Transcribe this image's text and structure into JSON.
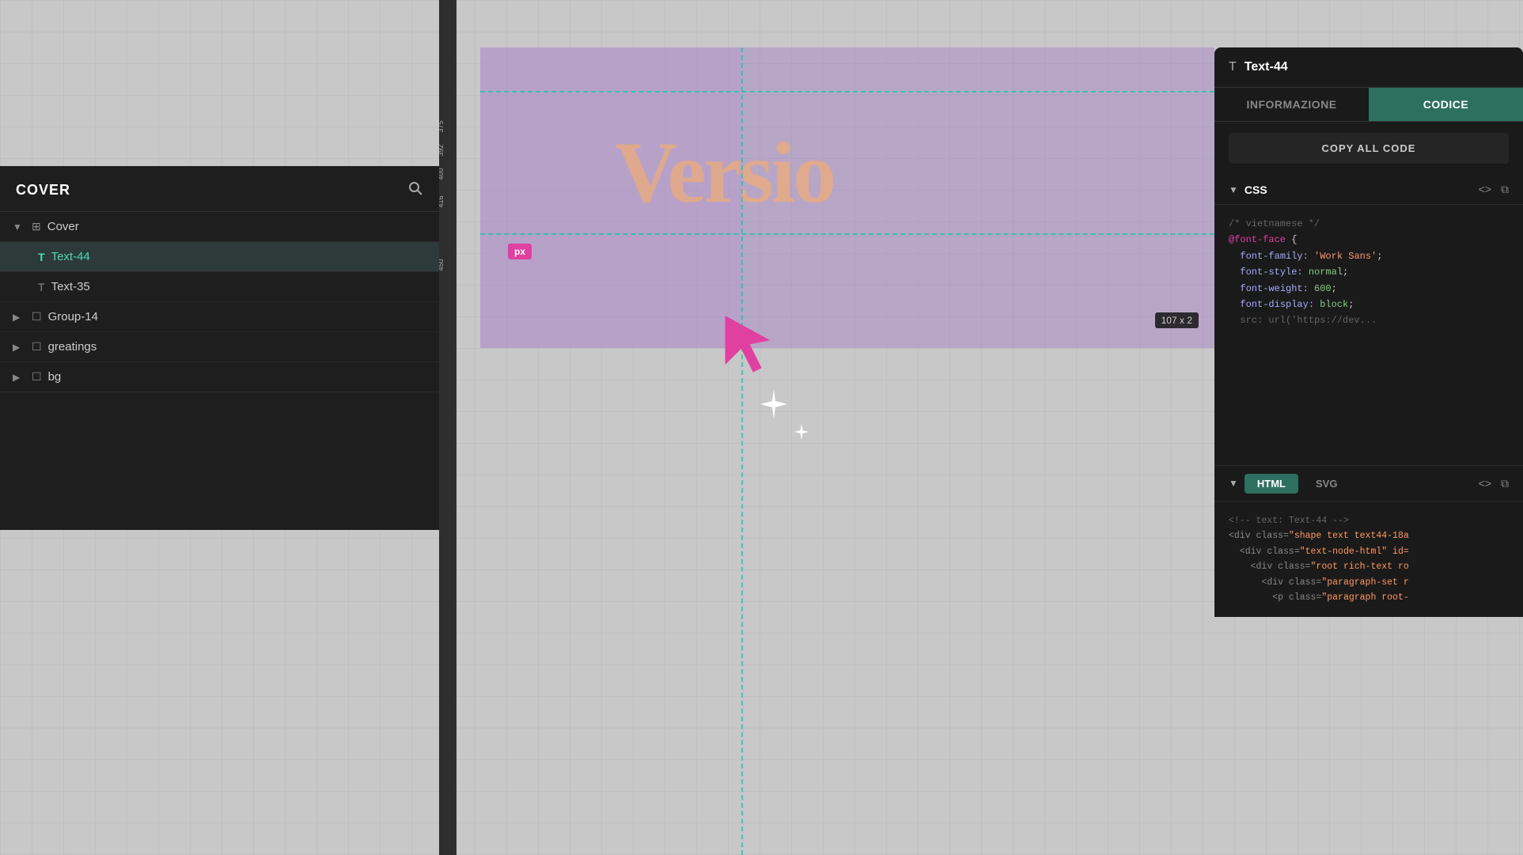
{
  "left_panel": {
    "title": "COVER",
    "layers": [
      {
        "id": "cover",
        "label": "Cover",
        "type": "frame",
        "indent": 0,
        "expanded": true,
        "active": false
      },
      {
        "id": "text44",
        "label": "Text-44",
        "type": "text",
        "indent": 1,
        "active": true
      },
      {
        "id": "text35",
        "label": "Text-35",
        "type": "text",
        "indent": 1,
        "active": false
      },
      {
        "id": "group14",
        "label": "Group-14",
        "type": "group",
        "indent": 0,
        "expanded": false,
        "active": false
      },
      {
        "id": "greatings",
        "label": "greatings",
        "type": "group",
        "indent": 0,
        "expanded": false,
        "active": false
      },
      {
        "id": "bg",
        "label": "bg",
        "type": "group",
        "indent": 0,
        "expanded": false,
        "active": false
      }
    ]
  },
  "canvas": {
    "px_badge": "px",
    "size_tooltip": "107 x 2",
    "canvas_text": "Versio",
    "ruler_labels": [
      "375",
      "392",
      "400",
      "416",
      "450"
    ]
  },
  "right_panel": {
    "title": "Text-44",
    "tabs": [
      {
        "label": "INFORMAZIONE",
        "active": false
      },
      {
        "label": "CODICE",
        "active": true
      }
    ],
    "copy_all_label": "COPY ALL CODE",
    "css_section": {
      "label": "CSS",
      "code_lines": [
        {
          "type": "comment",
          "text": "/* vietnamese */"
        },
        {
          "type": "keyword",
          "text": "@font-face {"
        },
        {
          "type": "property",
          "text": "  font-family:",
          "value": " 'Work Sans';"
        },
        {
          "type": "property",
          "text": "  font-style:",
          "value": " normal;"
        },
        {
          "type": "property",
          "text": "  font-weight:",
          "value": " 600;"
        },
        {
          "type": "property",
          "text": "  font-display:",
          "value": " block;"
        },
        {
          "type": "truncated",
          "text": "  src: url('https://dev'..."
        }
      ]
    },
    "html_section": {
      "label": "HTML",
      "sub_tabs": [
        "HTML",
        "SVG"
      ],
      "code_lines": [
        {
          "type": "comment",
          "text": "<!-- text: Text-44 -->"
        },
        {
          "type": "tag",
          "text": "<div class=\"shape text text44-18a"
        },
        {
          "type": "tag",
          "text": "  <div class=\"text-node-html\" id="
        },
        {
          "type": "tag",
          "text": "    <div class=\"root rich-text ro"
        },
        {
          "type": "tag",
          "text": "      <div class=\"paragraph-set r"
        },
        {
          "type": "tag",
          "text": "        <p class=\"paragraph root-"
        }
      ]
    }
  }
}
